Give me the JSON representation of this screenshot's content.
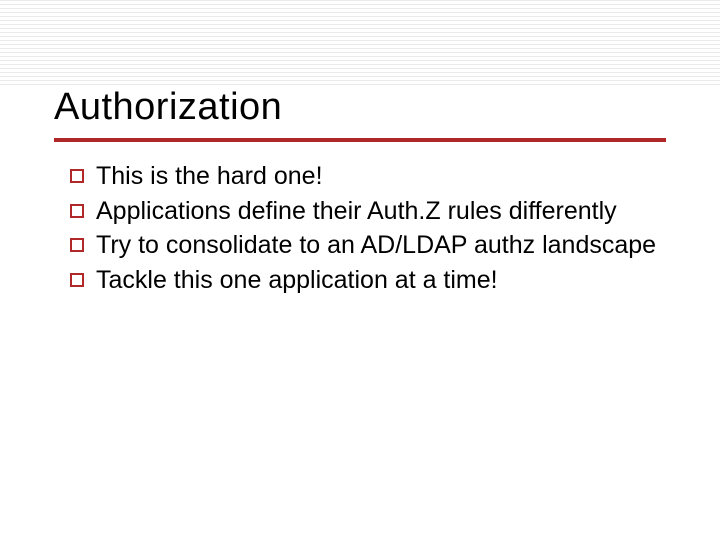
{
  "slide": {
    "title": "Authorization",
    "bullets": [
      "This is the hard one!",
      "Applications define their Auth.Z rules differently",
      "Try to consolidate to an AD/LDAP authz landscape",
      "Tackle this one application at a time!"
    ]
  },
  "colors": {
    "accent": "#b02828"
  }
}
